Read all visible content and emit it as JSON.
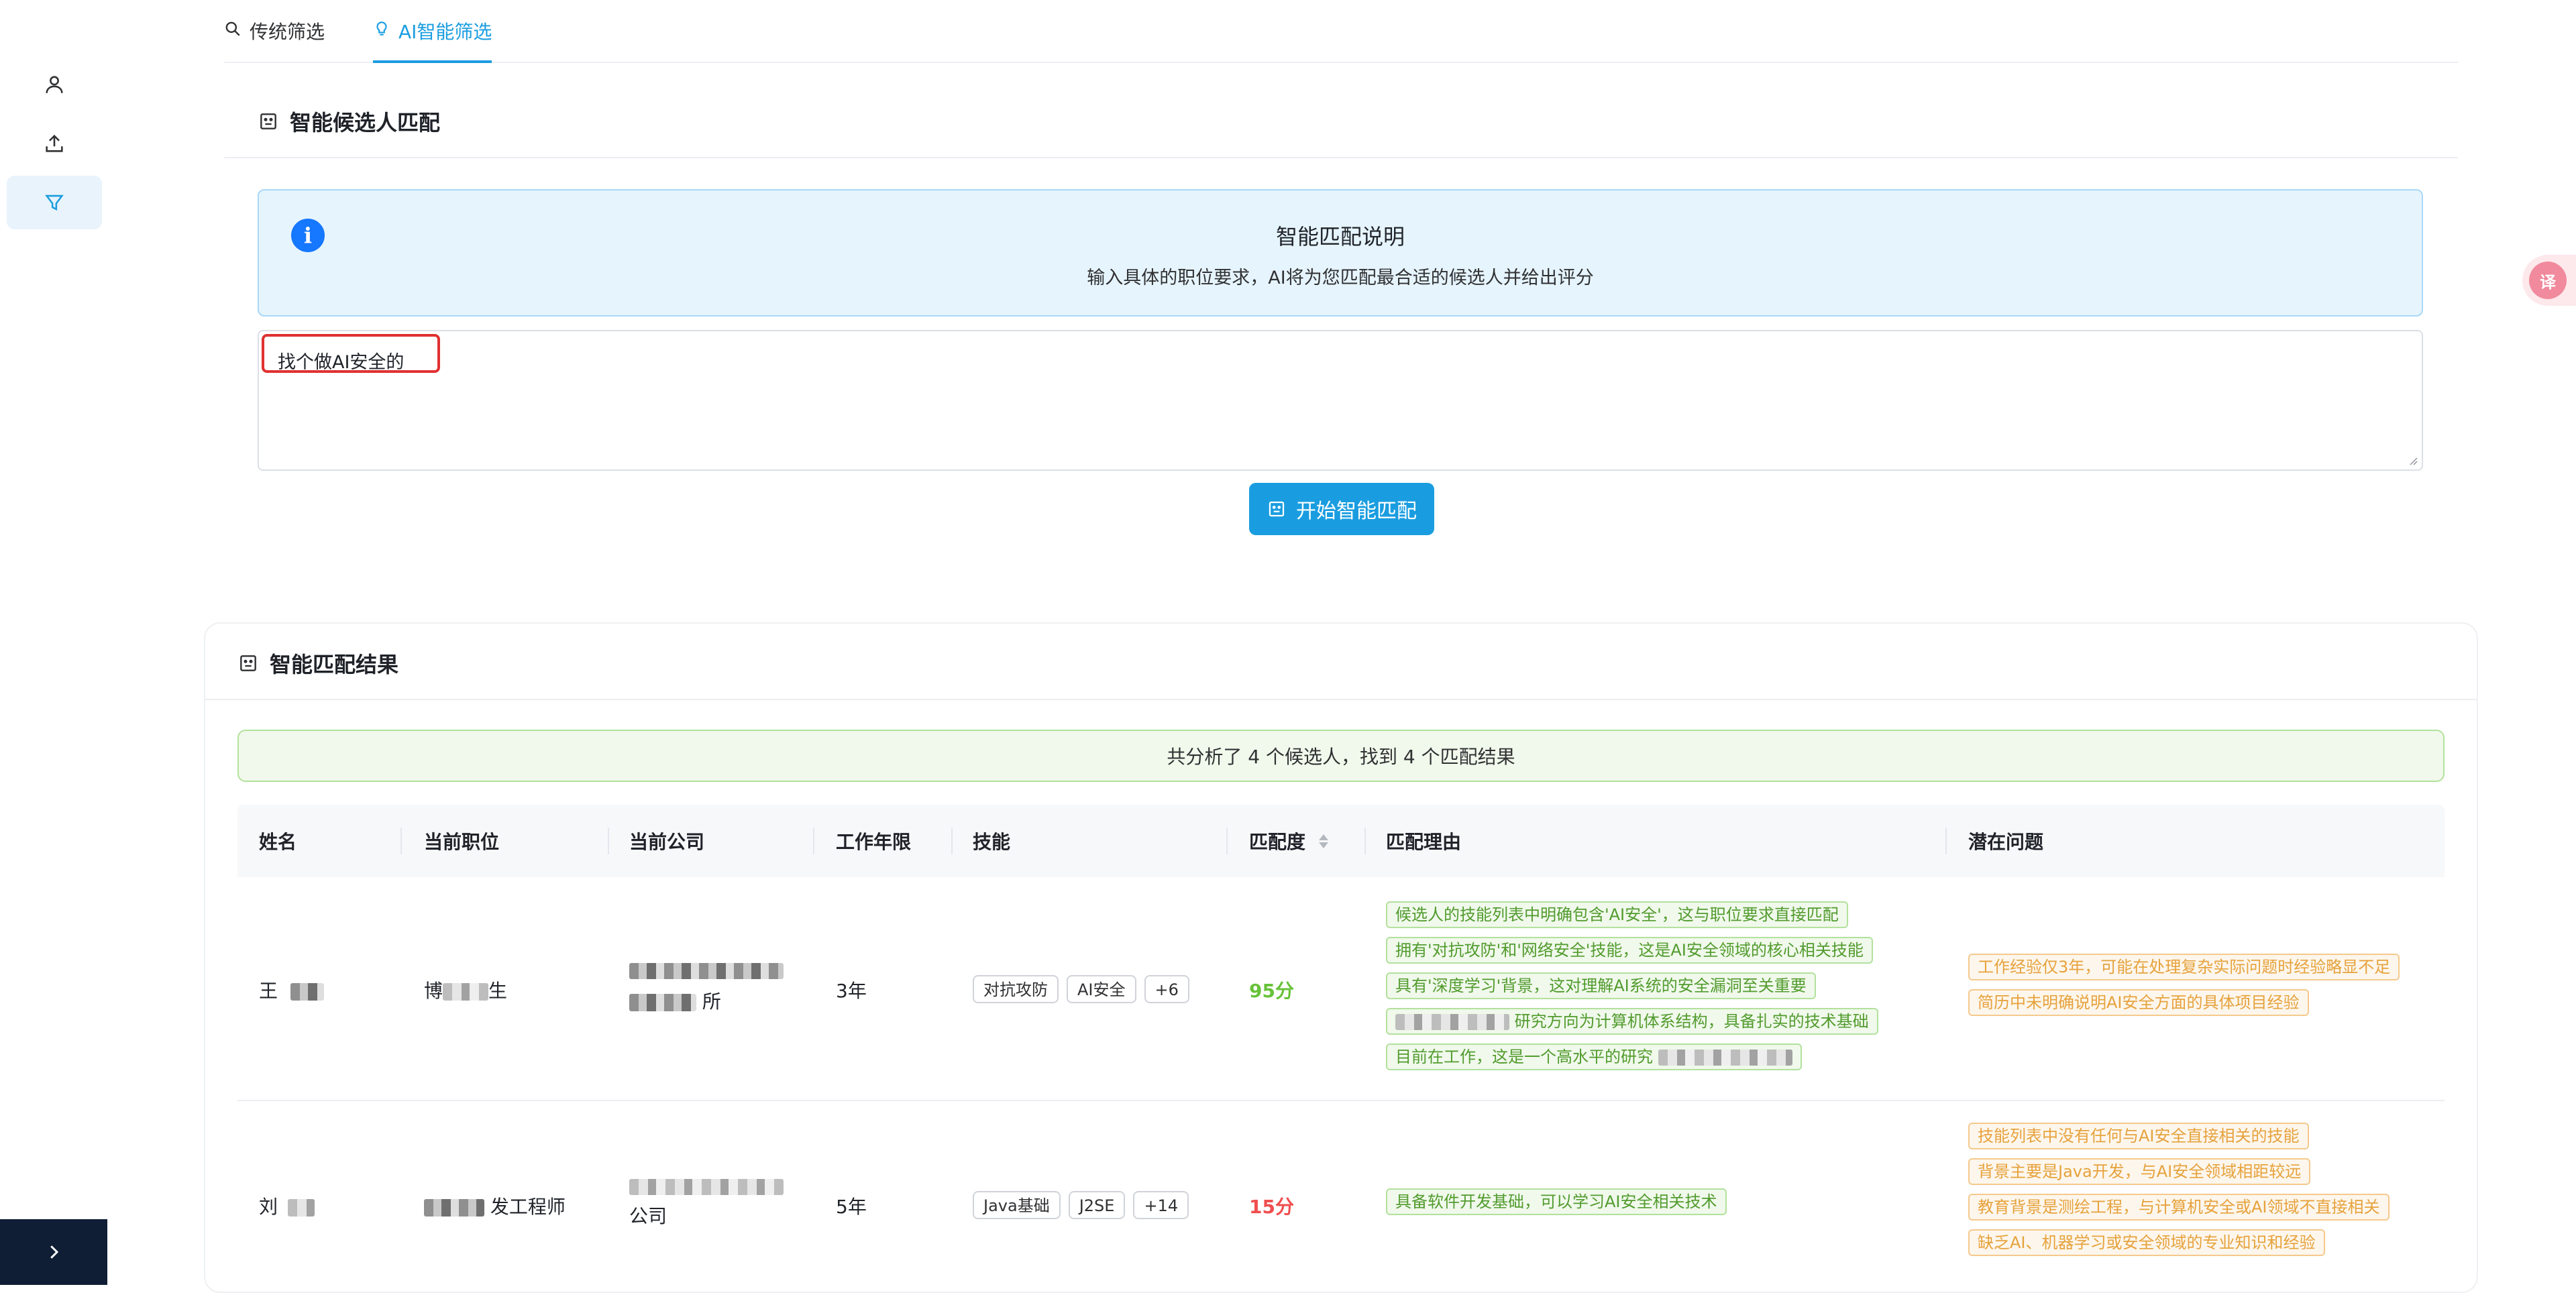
{
  "tabs": [
    {
      "label": "传统筛选",
      "icon": "search-icon",
      "active": false
    },
    {
      "label": "AI智能筛选",
      "icon": "bulb-icon",
      "active": true
    }
  ],
  "sidebar": {
    "items": [
      {
        "icon": "user-icon",
        "active": false
      },
      {
        "icon": "upload-icon",
        "active": false
      },
      {
        "icon": "filter-icon",
        "active": true
      }
    ],
    "collapse_icon": "chevron-right-icon"
  },
  "matching": {
    "title": "智能候选人匹配",
    "info_title": "智能匹配说明",
    "info_desc": "输入具体的职位要求，AI将为您匹配最合适的候选人并给出评分",
    "query_value": "找个做AI安全的",
    "button_label": "开始智能匹配"
  },
  "results": {
    "title": "智能匹配结果",
    "summary": "共分析了 4 个候选人，找到 4 个匹配结果",
    "columns": [
      "姓名",
      "当前职位",
      "当前公司",
      "工作年限",
      "技能",
      "匹配度",
      "匹配理由",
      "潜在问题"
    ],
    "rows": [
      {
        "name": "王",
        "position_prefix": "博",
        "position_suffix": "生",
        "company": "所",
        "years": "3年",
        "skills": [
          "对抗攻防",
          "AI安全",
          "+6"
        ],
        "score": "95分",
        "score_color": "#67c23a",
        "reasons": [
          "候选人的技能列表中明确包含'AI安全'，这与职位要求直接匹配",
          "拥有'对抗攻防'和'网络安全'技能，这是AI安全领域的核心相关技能",
          "具有'深度学习'背景，这对理解AI系统的安全漏洞至关重要",
          "研究方向为计算机体系结构，具备扎实的技术基础",
          "目前在工作，这是一个高水平的研究"
        ],
        "issues": [
          "工作经验仅3年，可能在处理复杂实际问题时经验略显不足",
          "简历中未明确说明AI安全方面的具体项目经验"
        ]
      },
      {
        "name": "刘",
        "position": "发工程师",
        "company": "公司",
        "years": "5年",
        "skills": [
          "Java基础",
          "J2SE",
          "+14"
        ],
        "score": "15分",
        "score_color": "#f04e4e",
        "reasons": [
          "具备软件开发基础，可以学习AI安全相关技术"
        ],
        "issues": [
          "技能列表中没有任何与AI安全直接相关的技能",
          "背景主要是Java开发，与AI安全领域相距较远",
          "教育背景是测绘工程，与计算机安全或AI领域不直接相关",
          "缺乏AI、机器学习或安全领域的专业知识和经验"
        ]
      }
    ]
  },
  "colors": {
    "accent": "#1a9de0",
    "info_bg": "#e6f4fd",
    "success_bg": "#f0f9eb",
    "warning_text": "#e6a23c"
  }
}
